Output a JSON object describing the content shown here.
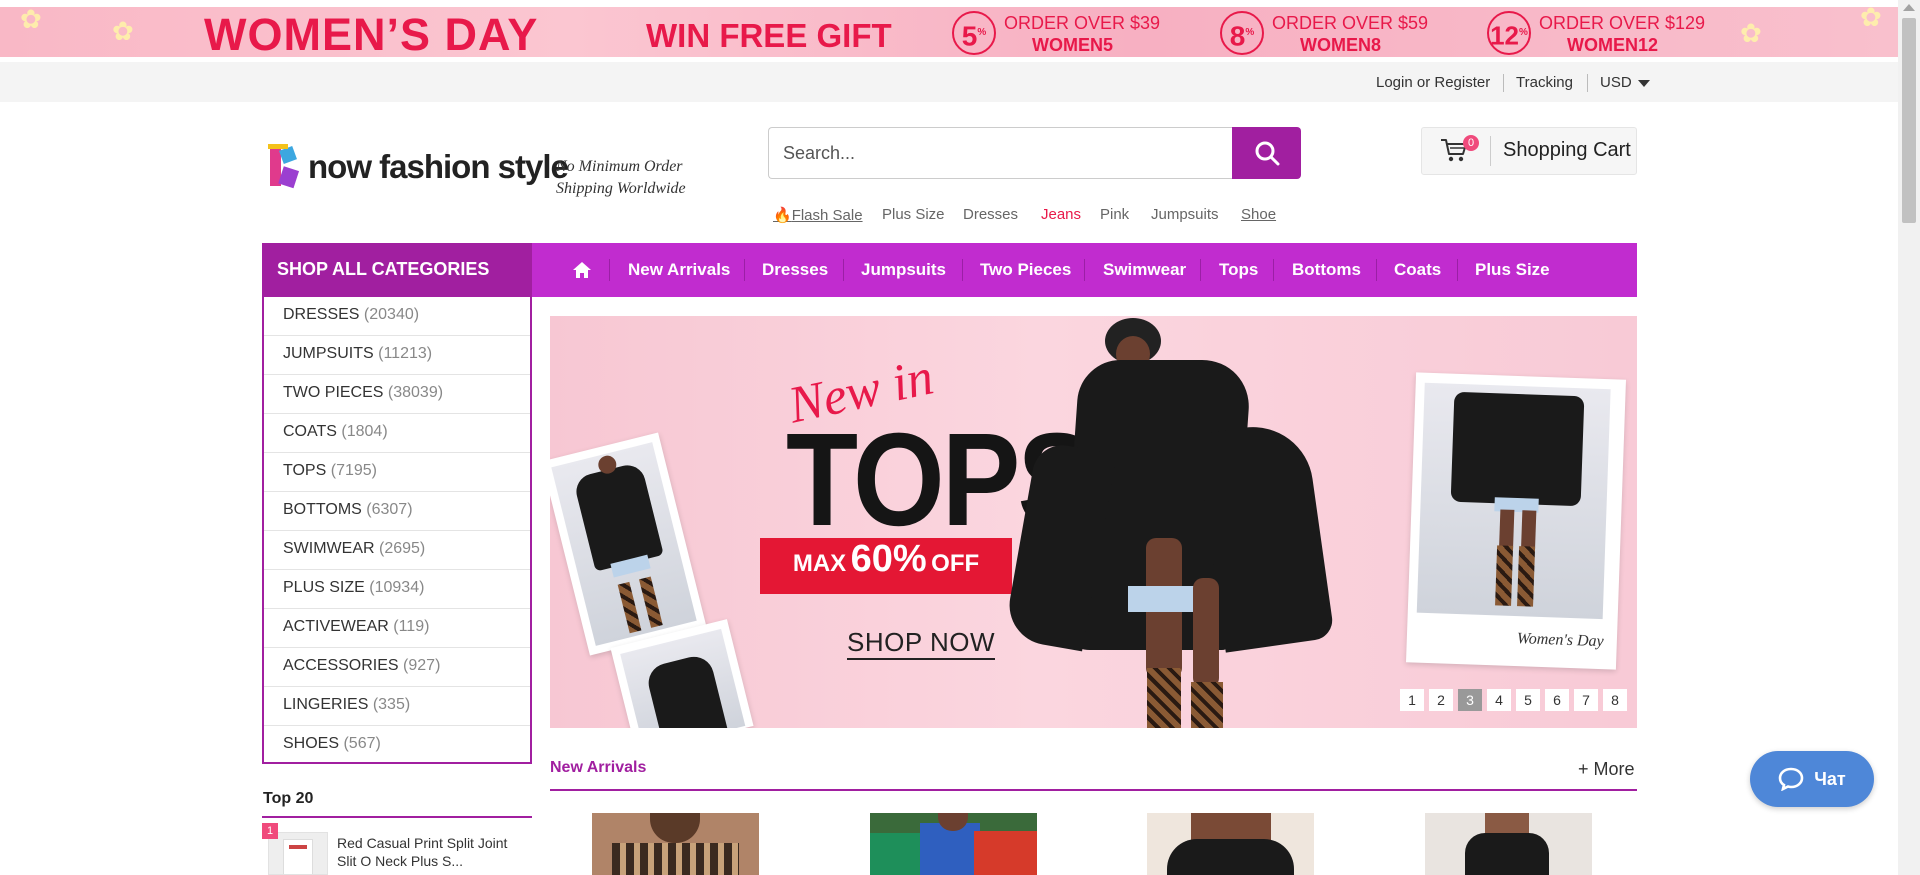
{
  "promo": {
    "headline": "WOMEN’S DAY",
    "gift": "WIN FREE GIFT",
    "coupons": [
      {
        "pct": "5",
        "order": "ORDER OVER $39",
        "code": "WOMEN5"
      },
      {
        "pct": "8",
        "order": "ORDER OVER $59",
        "code": "WOMEN8"
      },
      {
        "pct": "12",
        "order": "ORDER OVER $129",
        "code": "WOMEN12"
      }
    ]
  },
  "util": {
    "login": "Login or Register",
    "tracking": "Tracking",
    "currency": "USD"
  },
  "header": {
    "logo_k": "K",
    "logo_text": "now fashion style",
    "tagline1": "No Minimum Order",
    "tagline2": "Shipping Worldwide",
    "search_placeholder": "Search...",
    "hotlinks": [
      "Flash Sale",
      "Plus Size",
      "Dresses",
      "Jeans",
      "Pink",
      "Jumpsuits",
      "Shoe"
    ],
    "cart_count": "0",
    "cart_label": "Shopping Cart"
  },
  "nav": {
    "categories_title": "SHOP ALL CATEGORIES",
    "items": [
      "New Arrivals",
      "Dresses",
      "Jumpsuits",
      "Two Pieces",
      "Swimwear",
      "Tops",
      "Bottoms",
      "Coats",
      "Plus Size"
    ]
  },
  "categories": [
    {
      "name": "DRESSES",
      "count": "(20340)"
    },
    {
      "name": "JUMPSUITS",
      "count": "(11213)"
    },
    {
      "name": "TWO PIECES",
      "count": "(38039)"
    },
    {
      "name": "COATS",
      "count": "(1804)"
    },
    {
      "name": "TOPS",
      "count": "(7195)"
    },
    {
      "name": "BOTTOMS",
      "count": "(6307)"
    },
    {
      "name": "SWIMWEAR",
      "count": "(2695)"
    },
    {
      "name": "PLUS SIZE",
      "count": "(10934)"
    },
    {
      "name": "ACTIVEWEAR",
      "count": "(119)"
    },
    {
      "name": "ACCESSORIES",
      "count": "(927)"
    },
    {
      "name": "LINGERIES",
      "count": "(335)"
    },
    {
      "name": "SHOES",
      "count": "(567)"
    }
  ],
  "hero": {
    "script": "New in",
    "headline": "TOPS",
    "max": "MAX",
    "pct": "60%",
    "off": "OFF",
    "cta": "SHOP NOW",
    "signature": "Women's Day",
    "slides": [
      "1",
      "2",
      "3",
      "4",
      "5",
      "6",
      "7",
      "8"
    ],
    "active_slide": "3"
  },
  "new_arrivals": {
    "title": "New Arrivals",
    "more": "+ More"
  },
  "top20": {
    "title": "Top 20",
    "first_rank": "1",
    "first_title": "Red Casual Print Split Joint Slit O Neck Plus S..."
  },
  "chat": {
    "label": "Чат"
  },
  "colors": {
    "brand": "#a11fa0",
    "nav": "#c12ccf",
    "promo_red": "#e8194a",
    "chat_blue": "#4e87d8"
  }
}
